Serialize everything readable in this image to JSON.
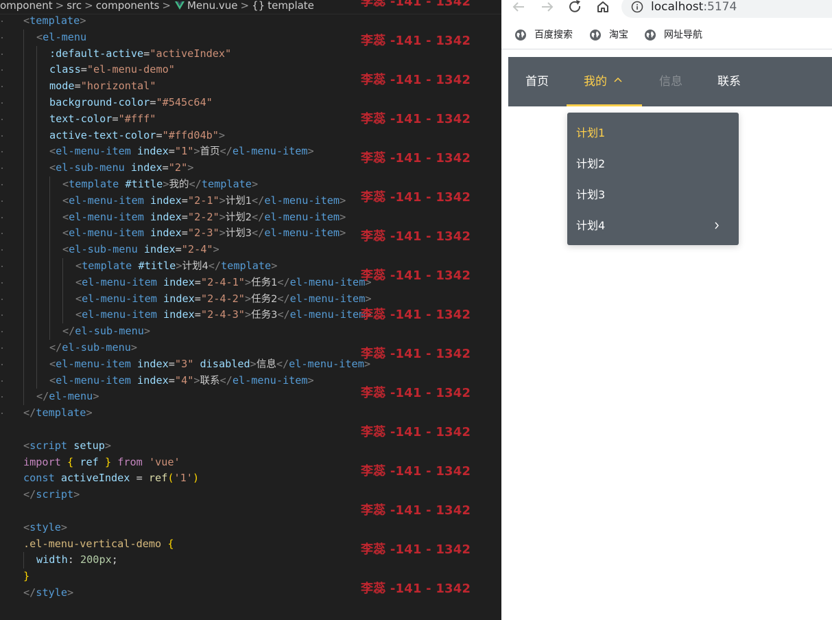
{
  "editor": {
    "breadcrumb": {
      "segments": [
        "omponent",
        "src",
        "components",
        "Menu.vue",
        "template"
      ],
      "separator": ">",
      "file_icon": "vue-logo-icon",
      "symbol_icon": "braces-icon",
      "symbol_glyph": "{}"
    },
    "lines": [
      {
        "dot": true,
        "tokens": [
          [
            "p",
            "<"
          ],
          [
            "t",
            "template"
          ],
          [
            "p",
            ">"
          ]
        ]
      },
      {
        "dot": true,
        "tokens": [
          [
            "p",
            "<"
          ],
          [
            "t",
            "el-menu"
          ]
        ]
      },
      {
        "dot": true,
        "tokens": [
          [
            "a",
            ":default-active"
          ],
          [
            "w",
            "="
          ],
          [
            "s",
            "\"activeIndex\""
          ]
        ]
      },
      {
        "dot": true,
        "tokens": [
          [
            "a",
            "class"
          ],
          [
            "w",
            "="
          ],
          [
            "s",
            "\"el-menu-demo\""
          ]
        ]
      },
      {
        "dot": true,
        "tokens": [
          [
            "a",
            "mode"
          ],
          [
            "w",
            "="
          ],
          [
            "s",
            "\"horizontal\""
          ]
        ]
      },
      {
        "dot": true,
        "tokens": [
          [
            "a",
            "background-color"
          ],
          [
            "w",
            "="
          ],
          [
            "s",
            "\"#545c64\""
          ]
        ]
      },
      {
        "dot": true,
        "tokens": [
          [
            "a",
            "text-color"
          ],
          [
            "w",
            "="
          ],
          [
            "s",
            "\"#fff\""
          ]
        ]
      },
      {
        "dot": true,
        "tokens": [
          [
            "a",
            "active-text-color"
          ],
          [
            "w",
            "="
          ],
          [
            "s",
            "\"#ffd04b\""
          ],
          [
            "p",
            ">"
          ]
        ]
      },
      {
        "dot": true,
        "tokens": [
          [
            "p",
            "<"
          ],
          [
            "t",
            "el-menu-item"
          ],
          [
            "w",
            " "
          ],
          [
            "a",
            "index"
          ],
          [
            "w",
            "="
          ],
          [
            "s",
            "\"1\""
          ],
          [
            "p",
            ">"
          ],
          [
            "cn",
            "首页"
          ],
          [
            "p",
            "</"
          ],
          [
            "t",
            "el-menu-item"
          ],
          [
            "p",
            ">"
          ]
        ]
      },
      {
        "dot": true,
        "tokens": [
          [
            "p",
            "<"
          ],
          [
            "t",
            "el-sub-menu"
          ],
          [
            "w",
            " "
          ],
          [
            "a",
            "index"
          ],
          [
            "w",
            "="
          ],
          [
            "s",
            "\"2\""
          ],
          [
            "p",
            ">"
          ]
        ]
      },
      {
        "dot": true,
        "tokens": [
          [
            "p",
            "<"
          ],
          [
            "t",
            "template"
          ],
          [
            "w",
            " "
          ],
          [
            "a",
            "#title"
          ],
          [
            "p",
            ">"
          ],
          [
            "cn",
            "我的"
          ],
          [
            "p",
            "</"
          ],
          [
            "t",
            "template"
          ],
          [
            "p",
            ">"
          ]
        ]
      },
      {
        "dot": true,
        "tokens": [
          [
            "p",
            "<"
          ],
          [
            "t",
            "el-menu-item"
          ],
          [
            "w",
            " "
          ],
          [
            "a",
            "index"
          ],
          [
            "w",
            "="
          ],
          [
            "s",
            "\"2-1\""
          ],
          [
            "p",
            ">"
          ],
          [
            "cn",
            "计划1"
          ],
          [
            "p",
            "</"
          ],
          [
            "t",
            "el-menu-item"
          ],
          [
            "p",
            ">"
          ]
        ]
      },
      {
        "dot": true,
        "tokens": [
          [
            "p",
            "<"
          ],
          [
            "t",
            "el-menu-item"
          ],
          [
            "w",
            " "
          ],
          [
            "a",
            "index"
          ],
          [
            "w",
            "="
          ],
          [
            "s",
            "\"2-2\""
          ],
          [
            "p",
            ">"
          ],
          [
            "cn",
            "计划2"
          ],
          [
            "p",
            "</"
          ],
          [
            "t",
            "el-menu-item"
          ],
          [
            "p",
            ">"
          ]
        ]
      },
      {
        "dot": true,
        "tokens": [
          [
            "p",
            "<"
          ],
          [
            "t",
            "el-menu-item"
          ],
          [
            "w",
            " "
          ],
          [
            "a",
            "index"
          ],
          [
            "w",
            "="
          ],
          [
            "s",
            "\"2-3\""
          ],
          [
            "p",
            ">"
          ],
          [
            "cn",
            "计划3"
          ],
          [
            "p",
            "</"
          ],
          [
            "t",
            "el-menu-item"
          ],
          [
            "p",
            ">"
          ]
        ]
      },
      {
        "dot": true,
        "tokens": [
          [
            "p",
            "<"
          ],
          [
            "t",
            "el-sub-menu"
          ],
          [
            "w",
            " "
          ],
          [
            "a",
            "index"
          ],
          [
            "w",
            "="
          ],
          [
            "s",
            "\"2-4\""
          ],
          [
            "p",
            ">"
          ]
        ]
      },
      {
        "dot": true,
        "tokens": [
          [
            "p",
            "<"
          ],
          [
            "t",
            "template"
          ],
          [
            "w",
            " "
          ],
          [
            "a",
            "#title"
          ],
          [
            "p",
            ">"
          ],
          [
            "cn",
            "计划4"
          ],
          [
            "p",
            "</"
          ],
          [
            "t",
            "template"
          ],
          [
            "p",
            ">"
          ]
        ]
      },
      {
        "dot": true,
        "tokens": [
          [
            "p",
            "<"
          ],
          [
            "t",
            "el-menu-item"
          ],
          [
            "w",
            " "
          ],
          [
            "a",
            "index"
          ],
          [
            "w",
            "="
          ],
          [
            "s",
            "\"2-4-1\""
          ],
          [
            "p",
            ">"
          ],
          [
            "cn",
            "任务1"
          ],
          [
            "p",
            "</"
          ],
          [
            "t",
            "el-menu-item"
          ],
          [
            "p",
            ">"
          ]
        ]
      },
      {
        "dot": true,
        "tokens": [
          [
            "p",
            "<"
          ],
          [
            "t",
            "el-menu-item"
          ],
          [
            "w",
            " "
          ],
          [
            "a",
            "index"
          ],
          [
            "w",
            "="
          ],
          [
            "s",
            "\"2-4-2\""
          ],
          [
            "p",
            ">"
          ],
          [
            "cn",
            "任务2"
          ],
          [
            "p",
            "</"
          ],
          [
            "t",
            "el-menu-item"
          ],
          [
            "p",
            ">"
          ]
        ]
      },
      {
        "dot": true,
        "tokens": [
          [
            "p",
            "<"
          ],
          [
            "t",
            "el-menu-item"
          ],
          [
            "w",
            " "
          ],
          [
            "a",
            "index"
          ],
          [
            "w",
            "="
          ],
          [
            "s",
            "\"2-4-3\""
          ],
          [
            "p",
            ">"
          ],
          [
            "cn",
            "任务3"
          ],
          [
            "p",
            "</"
          ],
          [
            "t",
            "el-menu-item"
          ],
          [
            "p",
            ">"
          ]
        ]
      },
      {
        "dot": true,
        "tokens": [
          [
            "p",
            "</"
          ],
          [
            "t",
            "el-sub-menu"
          ],
          [
            "p",
            ">"
          ]
        ]
      },
      {
        "dot": true,
        "tokens": [
          [
            "p",
            "</"
          ],
          [
            "t",
            "el-sub-menu"
          ],
          [
            "p",
            ">"
          ]
        ]
      },
      {
        "dot": true,
        "tokens": [
          [
            "p",
            "<"
          ],
          [
            "t",
            "el-menu-item"
          ],
          [
            "w",
            " "
          ],
          [
            "a",
            "index"
          ],
          [
            "w",
            "="
          ],
          [
            "s",
            "\"3\""
          ],
          [
            "w",
            " "
          ],
          [
            "a",
            "disabled"
          ],
          [
            "p",
            ">"
          ],
          [
            "cn",
            "信息"
          ],
          [
            "p",
            "</"
          ],
          [
            "t",
            "el-menu-item"
          ],
          [
            "p",
            ">"
          ]
        ]
      },
      {
        "dot": true,
        "tokens": [
          [
            "p",
            "<"
          ],
          [
            "t",
            "el-menu-item"
          ],
          [
            "w",
            " "
          ],
          [
            "a",
            "index"
          ],
          [
            "w",
            "="
          ],
          [
            "s",
            "\"4\""
          ],
          [
            "p",
            ">"
          ],
          [
            "cn",
            "联系"
          ],
          [
            "p",
            "</"
          ],
          [
            "t",
            "el-menu-item"
          ],
          [
            "p",
            ">"
          ]
        ]
      },
      {
        "dot": true,
        "tokens": [
          [
            "p",
            "</"
          ],
          [
            "t",
            "el-menu"
          ],
          [
            "p",
            ">"
          ]
        ]
      },
      {
        "dot": true,
        "tokens": [
          [
            "p",
            "</"
          ],
          [
            "t",
            "template"
          ],
          [
            "p",
            ">"
          ]
        ]
      },
      {
        "dot": false,
        "tokens": []
      },
      {
        "dot": false,
        "tokens": [
          [
            "p",
            "<"
          ],
          [
            "t",
            "script"
          ],
          [
            "w",
            " "
          ],
          [
            "a",
            "setup"
          ],
          [
            "p",
            ">"
          ]
        ]
      },
      {
        "dot": false,
        "tokens": [
          [
            "k",
            "import"
          ],
          [
            "w",
            " "
          ],
          [
            "b",
            "{"
          ],
          [
            "w",
            " "
          ],
          [
            "a",
            "ref"
          ],
          [
            "w",
            " "
          ],
          [
            "b",
            "}"
          ],
          [
            "w",
            " "
          ],
          [
            "k",
            "from"
          ],
          [
            "w",
            " "
          ],
          [
            "s",
            "'vue'"
          ]
        ]
      },
      {
        "dot": false,
        "tokens": [
          [
            "t",
            "const"
          ],
          [
            "w",
            " "
          ],
          [
            "a",
            "activeIndex"
          ],
          [
            "w",
            " = "
          ],
          [
            "f",
            "ref"
          ],
          [
            "b",
            "("
          ],
          [
            "s",
            "'1'"
          ],
          [
            "b",
            ")"
          ]
        ]
      },
      {
        "dot": false,
        "tokens": [
          [
            "p",
            "</"
          ],
          [
            "t",
            "script"
          ],
          [
            "p",
            ">"
          ]
        ]
      },
      {
        "dot": false,
        "tokens": []
      },
      {
        "dot": false,
        "tokens": [
          [
            "p",
            "<"
          ],
          [
            "t",
            "style"
          ],
          [
            "p",
            ">"
          ]
        ]
      },
      {
        "dot": false,
        "tokens": [
          [
            "c",
            ".el-menu-vertical-demo"
          ],
          [
            "w",
            " "
          ],
          [
            "b",
            "{"
          ]
        ]
      },
      {
        "dot": false,
        "tokens": [
          [
            "a",
            "width"
          ],
          [
            "w",
            ": "
          ],
          [
            "n",
            "200px"
          ],
          [
            "w",
            ";"
          ]
        ]
      },
      {
        "dot": false,
        "tokens": [
          [
            "b",
            "}"
          ]
        ]
      },
      {
        "dot": false,
        "tokens": [
          [
            "p",
            "</"
          ],
          [
            "t",
            "style"
          ],
          [
            "p",
            ">"
          ]
        ]
      }
    ]
  },
  "watermark": {
    "text": "李蕊 -141 - 1342",
    "repeat": 16
  },
  "browser": {
    "nav": {
      "back_icon": "back-arrow-icon",
      "forward_icon": "forward-arrow-icon",
      "reload_icon": "reload-icon",
      "home_icon": "home-icon",
      "info_icon": "site-info-icon"
    },
    "url": {
      "host": "localhost",
      "port": ":5174"
    },
    "bookmarks": [
      {
        "label": "百度搜索",
        "icon": "globe-icon"
      },
      {
        "label": "淘宝",
        "icon": "globe-icon"
      },
      {
        "label": "网址导航",
        "icon": "globe-icon"
      }
    ],
    "menu": {
      "background": "#545c64",
      "text_color": "#ffffff",
      "active_color": "#ffd04b",
      "items": [
        {
          "label": "首页",
          "state": "normal"
        },
        {
          "label": "我的",
          "state": "active",
          "icon": "chevron-up-icon"
        },
        {
          "label": "信息",
          "state": "disabled"
        },
        {
          "label": "联系",
          "state": "normal"
        }
      ]
    },
    "dropdown": {
      "items": [
        {
          "label": "计划1",
          "state": "active"
        },
        {
          "label": "计划2",
          "state": "normal"
        },
        {
          "label": "计划3",
          "state": "normal"
        },
        {
          "label": "计划4",
          "state": "normal",
          "icon": "chevron-right-icon"
        }
      ]
    }
  }
}
